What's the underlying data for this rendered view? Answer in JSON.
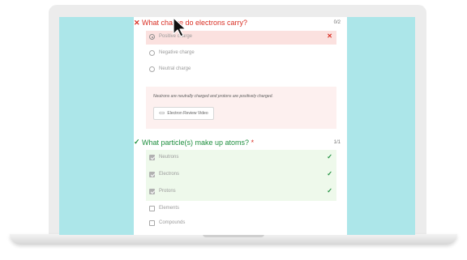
{
  "colors": {
    "screen_bg": "#ace6e9",
    "incorrect": "#d93025",
    "correct": "#1e8e3e",
    "incorrect_bg": "#fbe1df",
    "correct_bg": "#e6f4e3"
  },
  "question1": {
    "status_icon": "x-icon",
    "status_glyph": "✕",
    "title": "What charge do electrons carry?",
    "score": "0/2",
    "options": [
      {
        "label": "Positive charge",
        "selected": true,
        "result_glyph": "✕"
      },
      {
        "label": "Negative charge",
        "selected": false
      },
      {
        "label": "Neutral charge",
        "selected": false
      }
    ],
    "feedback": {
      "text": "Neutrons are neutrally charged and protons are positively charged.",
      "link_icon": "link-icon",
      "link_glyph": "⊂⊃",
      "button_label": "Electron Review Video"
    }
  },
  "question2": {
    "status_icon": "check-icon",
    "status_glyph": "✓",
    "title": "What particle(s) make up atoms?",
    "required_mark": "*",
    "score": "1/1",
    "options": [
      {
        "label": "Neutrons",
        "checked": true,
        "result_glyph": "✓"
      },
      {
        "label": "Electrons",
        "checked": true,
        "result_glyph": "✓"
      },
      {
        "label": "Protons",
        "checked": true,
        "result_glyph": "✓"
      },
      {
        "label": "Elements",
        "checked": false
      },
      {
        "label": "Compounds",
        "checked": false
      }
    ]
  },
  "cursor_icon": "mouse-pointer-icon"
}
